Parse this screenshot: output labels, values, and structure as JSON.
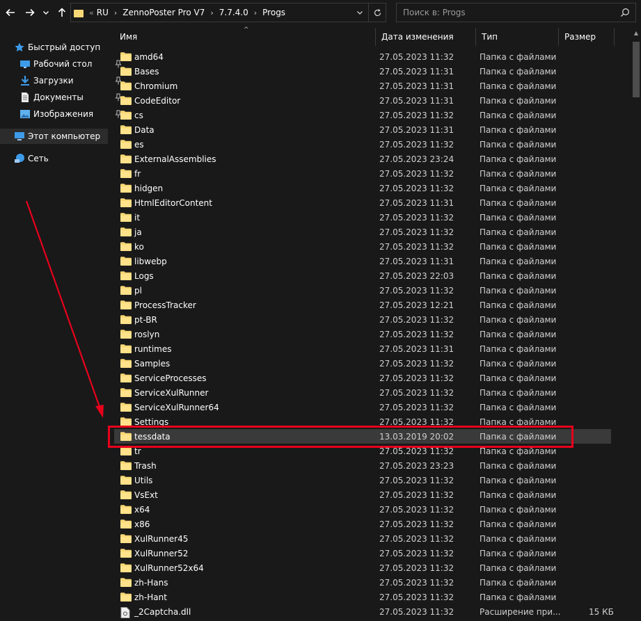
{
  "nav": {
    "back_icon": "arrow-left-icon",
    "forward_icon": "arrow-right-icon",
    "recent_icon": "chevron-down-icon",
    "up_icon": "arrow-up-icon"
  },
  "address": {
    "overflow": "«",
    "crumbs": [
      "RU",
      "ZennoPoster Pro V7",
      "7.7.4.0",
      "Progs"
    ],
    "dropdown_icon": "chevron-down-icon",
    "refresh_icon": "refresh-icon"
  },
  "search": {
    "placeholder": "Поиск в: Progs"
  },
  "sidebar": {
    "quick_access": "Быстрый доступ",
    "items": [
      {
        "label": "Рабочий стол",
        "icon": "desktop-icon",
        "pinned": true
      },
      {
        "label": "Загрузки",
        "icon": "download-icon",
        "pinned": true
      },
      {
        "label": "Документы",
        "icon": "document-icon",
        "pinned": true
      },
      {
        "label": "Изображения",
        "icon": "image-icon",
        "pinned": true
      }
    ],
    "this_pc": "Этот компьютер",
    "network": "Сеть"
  },
  "columns": {
    "name": "Имя",
    "date": "Дата изменения",
    "type": "Тип",
    "size": "Размер"
  },
  "files": [
    {
      "name": "amd64",
      "date": "27.05.2023 11:32",
      "type": "Папка с файлами",
      "size": ""
    },
    {
      "name": "Bases",
      "date": "27.05.2023 11:31",
      "type": "Папка с файлами",
      "size": ""
    },
    {
      "name": "Chromium",
      "date": "27.05.2023 11:31",
      "type": "Папка с файлами",
      "size": ""
    },
    {
      "name": "CodeEditor",
      "date": "27.05.2023 11:31",
      "type": "Папка с файлами",
      "size": ""
    },
    {
      "name": "cs",
      "date": "27.05.2023 11:32",
      "type": "Папка с файлами",
      "size": ""
    },
    {
      "name": "Data",
      "date": "27.05.2023 11:31",
      "type": "Папка с файлами",
      "size": ""
    },
    {
      "name": "es",
      "date": "27.05.2023 11:32",
      "type": "Папка с файлами",
      "size": ""
    },
    {
      "name": "ExternalAssemblies",
      "date": "27.05.2023 23:24",
      "type": "Папка с файлами",
      "size": ""
    },
    {
      "name": "fr",
      "date": "27.05.2023 11:32",
      "type": "Папка с файлами",
      "size": ""
    },
    {
      "name": "hidgen",
      "date": "27.05.2023 11:32",
      "type": "Папка с файлами",
      "size": ""
    },
    {
      "name": "HtmlEditorContent",
      "date": "27.05.2023 11:31",
      "type": "Папка с файлами",
      "size": ""
    },
    {
      "name": "it",
      "date": "27.05.2023 11:32",
      "type": "Папка с файлами",
      "size": ""
    },
    {
      "name": "ja",
      "date": "27.05.2023 11:32",
      "type": "Папка с файлами",
      "size": ""
    },
    {
      "name": "ko",
      "date": "27.05.2023 11:32",
      "type": "Папка с файлами",
      "size": ""
    },
    {
      "name": "libwebp",
      "date": "27.05.2023 11:31",
      "type": "Папка с файлами",
      "size": ""
    },
    {
      "name": "Logs",
      "date": "27.05.2023 22:03",
      "type": "Папка с файлами",
      "size": ""
    },
    {
      "name": "pl",
      "date": "27.05.2023 11:32",
      "type": "Папка с файлами",
      "size": ""
    },
    {
      "name": "ProcessTracker",
      "date": "27.05.2023 12:21",
      "type": "Папка с файлами",
      "size": ""
    },
    {
      "name": "pt-BR",
      "date": "27.05.2023 11:32",
      "type": "Папка с файлами",
      "size": ""
    },
    {
      "name": "roslyn",
      "date": "27.05.2023 11:32",
      "type": "Папка с файлами",
      "size": ""
    },
    {
      "name": "runtimes",
      "date": "27.05.2023 11:31",
      "type": "Папка с файлами",
      "size": ""
    },
    {
      "name": "Samples",
      "date": "27.05.2023 11:32",
      "type": "Папка с файлами",
      "size": ""
    },
    {
      "name": "ServiceProcesses",
      "date": "27.05.2023 11:32",
      "type": "Папка с файлами",
      "size": ""
    },
    {
      "name": "ServiceXulRunner",
      "date": "27.05.2023 11:32",
      "type": "Папка с файлами",
      "size": ""
    },
    {
      "name": "ServiceXulRunner64",
      "date": "27.05.2023 11:32",
      "type": "Папка с файлами",
      "size": ""
    },
    {
      "name": "Settings",
      "date": "27.05.2023 11:32",
      "type": "Папка с файлами",
      "size": ""
    },
    {
      "name": "tessdata",
      "date": "13.03.2019 20:02",
      "type": "Папка с файлами",
      "size": "",
      "selected": true
    },
    {
      "name": "tr",
      "date": "27.05.2023 11:32",
      "type": "Папка с файлами",
      "size": ""
    },
    {
      "name": "Trash",
      "date": "27.05.2023 23:23",
      "type": "Папка с файлами",
      "size": ""
    },
    {
      "name": "Utils",
      "date": "27.05.2023 11:32",
      "type": "Папка с файлами",
      "size": ""
    },
    {
      "name": "VsExt",
      "date": "27.05.2023 11:32",
      "type": "Папка с файлами",
      "size": ""
    },
    {
      "name": "x64",
      "date": "27.05.2023 11:32",
      "type": "Папка с файлами",
      "size": ""
    },
    {
      "name": "x86",
      "date": "27.05.2023 11:32",
      "type": "Папка с файлами",
      "size": ""
    },
    {
      "name": "XulRunner45",
      "date": "27.05.2023 11:32",
      "type": "Папка с файлами",
      "size": ""
    },
    {
      "name": "XulRunner52",
      "date": "27.05.2023 11:32",
      "type": "Папка с файлами",
      "size": ""
    },
    {
      "name": "XulRunner52x64",
      "date": "27.05.2023 11:32",
      "type": "Папка с файлами",
      "size": ""
    },
    {
      "name": "zh-Hans",
      "date": "27.05.2023 11:32",
      "type": "Папка с файлами",
      "size": ""
    },
    {
      "name": "zh-Hant",
      "date": "27.05.2023 11:32",
      "type": "Папка с файлами",
      "size": ""
    },
    {
      "name": "_2Captcha.dll",
      "date": "27.05.2023 11:32",
      "type": "Расширение при...",
      "size": "15 КБ",
      "kind": "file"
    }
  ],
  "colors": {
    "background": "#191919",
    "folder": "#f8d775",
    "highlight": "#e8001c",
    "selected_row": "#3a3a3a"
  }
}
